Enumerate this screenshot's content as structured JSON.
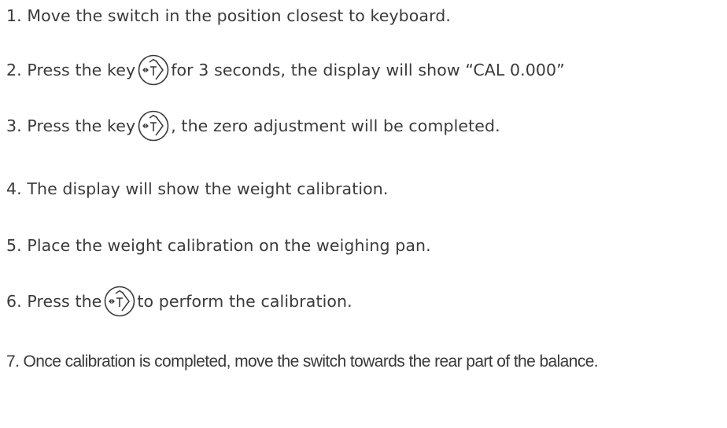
{
  "steps": [
    {
      "prefix": "1. Move the switch in the position closest to keyboard.",
      "suffix": ""
    },
    {
      "prefix": "2. Press the key",
      "suffix": "for 3 seconds, the display will show “CAL 0.000”"
    },
    {
      "prefix": "3. Press the key",
      "suffix": ", the zero adjustment will be completed."
    },
    {
      "prefix": "4. The display will show the weight calibration.",
      "suffix": ""
    },
    {
      "prefix": "5. Place the weight calibration on the weighing pan.",
      "suffix": ""
    },
    {
      "prefix": "6. Press the",
      "suffix": "to perform the calibration."
    },
    {
      "prefix": "7. Once calibration is completed, move the switch towards the rear part of the balance.",
      "suffix": ""
    }
  ],
  "icons": {
    "key": "tare-key-icon"
  },
  "colors": {
    "text": "#3a3a3a"
  }
}
